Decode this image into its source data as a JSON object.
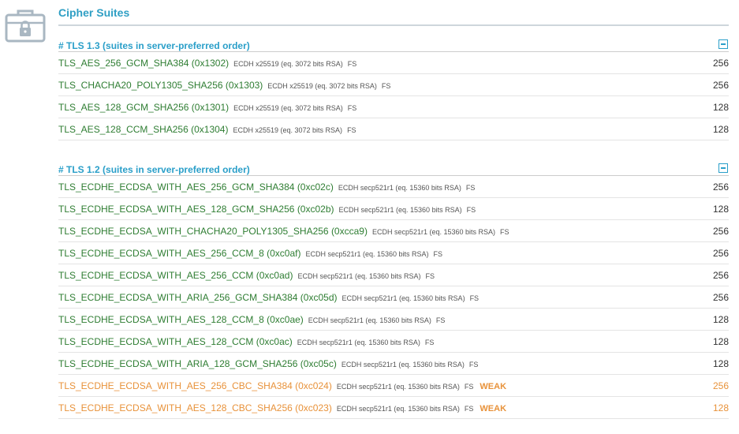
{
  "section": {
    "title": "Cipher Suites",
    "icon": "suitcase-lock-icon"
  },
  "groups": [
    {
      "header": "# TLS 1.3 (suites in server-preferred order)",
      "suites": [
        {
          "name": "TLS_AES_256_GCM_SHA384",
          "code": "(0x1302)",
          "kex": "ECDH x25519 (eq. 3072 bits RSA)",
          "fs": "FS",
          "flag": "",
          "bits": "256",
          "weak": false
        },
        {
          "name": "TLS_CHACHA20_POLY1305_SHA256",
          "code": "(0x1303)",
          "kex": "ECDH x25519 (eq. 3072 bits RSA)",
          "fs": "FS",
          "flag": "",
          "bits": "256",
          "weak": false
        },
        {
          "name": "TLS_AES_128_GCM_SHA256",
          "code": "(0x1301)",
          "kex": "ECDH x25519 (eq. 3072 bits RSA)",
          "fs": "FS",
          "flag": "",
          "bits": "128",
          "weak": false
        },
        {
          "name": "TLS_AES_128_CCM_SHA256",
          "code": "(0x1304)",
          "kex": "ECDH x25519 (eq. 3072 bits RSA)",
          "fs": "FS",
          "flag": "",
          "bits": "128",
          "weak": false
        }
      ]
    },
    {
      "header": "# TLS 1.2 (suites in server-preferred order)",
      "suites": [
        {
          "name": "TLS_ECDHE_ECDSA_WITH_AES_256_GCM_SHA384",
          "code": "(0xc02c)",
          "kex": "ECDH secp521r1 (eq. 15360 bits RSA)",
          "fs": "FS",
          "flag": "",
          "bits": "256",
          "weak": false
        },
        {
          "name": "TLS_ECDHE_ECDSA_WITH_AES_128_GCM_SHA256",
          "code": "(0xc02b)",
          "kex": "ECDH secp521r1 (eq. 15360 bits RSA)",
          "fs": "FS",
          "flag": "",
          "bits": "128",
          "weak": false
        },
        {
          "name": "TLS_ECDHE_ECDSA_WITH_CHACHA20_POLY1305_SHA256",
          "code": "(0xcca9)",
          "kex": "ECDH secp521r1 (eq. 15360 bits RSA)",
          "fs": "FS",
          "flag": "",
          "bits": "256",
          "weak": false
        },
        {
          "name": "TLS_ECDHE_ECDSA_WITH_AES_256_CCM_8",
          "code": "(0xc0af)",
          "kex": "ECDH secp521r1 (eq. 15360 bits RSA)",
          "fs": "FS",
          "flag": "",
          "bits": "256",
          "weak": false
        },
        {
          "name": "TLS_ECDHE_ECDSA_WITH_AES_256_CCM",
          "code": "(0xc0ad)",
          "kex": "ECDH secp521r1 (eq. 15360 bits RSA)",
          "fs": "FS",
          "flag": "",
          "bits": "256",
          "weak": false
        },
        {
          "name": "TLS_ECDHE_ECDSA_WITH_ARIA_256_GCM_SHA384",
          "code": "(0xc05d)",
          "kex": "ECDH secp521r1 (eq. 15360 bits RSA)",
          "fs": "FS",
          "flag": "",
          "bits": "256",
          "weak": false
        },
        {
          "name": "TLS_ECDHE_ECDSA_WITH_AES_128_CCM_8",
          "code": "(0xc0ae)",
          "kex": "ECDH secp521r1 (eq. 15360 bits RSA)",
          "fs": "FS",
          "flag": "",
          "bits": "128",
          "weak": false
        },
        {
          "name": "TLS_ECDHE_ECDSA_WITH_AES_128_CCM",
          "code": "(0xc0ac)",
          "kex": "ECDH secp521r1 (eq. 15360 bits RSA)",
          "fs": "FS",
          "flag": "",
          "bits": "128",
          "weak": false
        },
        {
          "name": "TLS_ECDHE_ECDSA_WITH_ARIA_128_GCM_SHA256",
          "code": "(0xc05c)",
          "kex": "ECDH secp521r1 (eq. 15360 bits RSA)",
          "fs": "FS",
          "flag": "",
          "bits": "128",
          "weak": false
        },
        {
          "name": "TLS_ECDHE_ECDSA_WITH_AES_256_CBC_SHA384",
          "code": "(0xc024)",
          "kex": "ECDH secp521r1 (eq. 15360 bits RSA)",
          "fs": "FS",
          "flag": "WEAK",
          "bits": "256",
          "weak": true
        },
        {
          "name": "TLS_ECDHE_ECDSA_WITH_AES_128_CBC_SHA256",
          "code": "(0xc023)",
          "kex": "ECDH secp521r1 (eq. 15360 bits RSA)",
          "fs": "FS",
          "flag": "WEAK",
          "bits": "128",
          "weak": true
        }
      ]
    }
  ],
  "colors": {
    "accent": "#2a9fc9",
    "strong": "#2e7d32",
    "weak": "#e8923a"
  }
}
